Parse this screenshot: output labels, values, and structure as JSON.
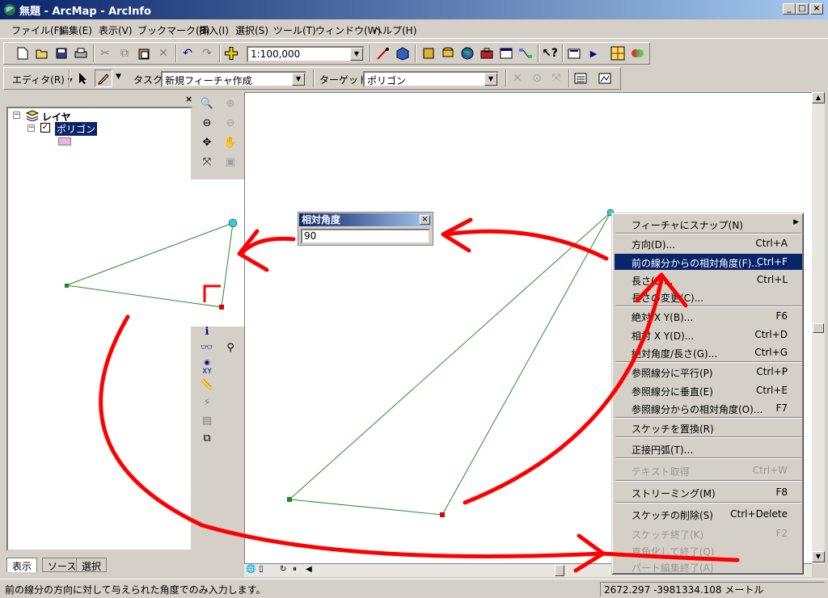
{
  "window": {
    "title": "無題 - ArcMap - ArcInfo",
    "minimize": "_",
    "maximize": "□",
    "close": "×"
  },
  "menubar": [
    "ファイル(F)",
    "編集(E)",
    "表示(V)",
    "ブックマーク(B)",
    "挿入(I)",
    "選択(S)",
    "ツール(T)",
    "ウィンドウ(W)",
    "ヘルプ(H)"
  ],
  "toolbar": {
    "scale": "1:100,000"
  },
  "editor_toolbar": {
    "editor_label": "エディタ(R) ▾",
    "task_label": "タスク:",
    "task_value": "新規フィーチャ作成",
    "target_label": "ターゲット:",
    "target_value": "ポリゴン"
  },
  "toc": {
    "root_label": "レイヤ",
    "layer_label": "ポリゴン",
    "symbol_color": "#e8b4e8",
    "tabs": [
      "表示",
      "ソース",
      "選択"
    ]
  },
  "angle_dialog": {
    "title": "相対角度",
    "value": "90"
  },
  "context_menu": {
    "items": [
      {
        "label": "フィーチャにスナップ(N)",
        "shortcut": "▶",
        "state": "normal"
      },
      {
        "label": "方向(D)...",
        "shortcut": "Ctrl+A",
        "state": "normal"
      },
      {
        "label": "前の線分からの相対角度(F)...",
        "shortcut": "Ctrl+F",
        "state": "highlight"
      },
      {
        "label": "長さ(L)...",
        "shortcut": "Ctrl+L",
        "state": "normal"
      },
      {
        "label": "長さの変更(C)...",
        "shortcut": "",
        "state": "normal"
      },
      {
        "label": "絶対 X Y(B)...",
        "shortcut": "F6",
        "state": "normal"
      },
      {
        "label": "相対 X Y(D)...",
        "shortcut": "Ctrl+D",
        "state": "normal"
      },
      {
        "label": "絶対角度/長さ(G)...",
        "shortcut": "Ctrl+G",
        "state": "normal"
      },
      {
        "label": "参照線分に平行(P)",
        "shortcut": "Ctrl+P",
        "state": "normal"
      },
      {
        "label": "参照線分に垂直(E)",
        "shortcut": "Ctrl+E",
        "state": "normal"
      },
      {
        "label": "参照線分からの相対角度(O)...",
        "shortcut": "F7",
        "state": "normal"
      },
      {
        "label": "スケッチを置換(R)",
        "shortcut": "",
        "state": "normal"
      },
      {
        "label": "正接円弧(T)...",
        "shortcut": "",
        "state": "normal"
      },
      {
        "label": "テキスト取得",
        "shortcut": "Ctrl+W",
        "state": "disabled"
      },
      {
        "label": "ストリーミング(M)",
        "shortcut": "F8",
        "state": "normal"
      },
      {
        "label": "スケッチの削除(S)",
        "shortcut": "Ctrl+Delete",
        "state": "normal"
      },
      {
        "label": "スケッチ終了(K)",
        "shortcut": "F2",
        "state": "disabled"
      },
      {
        "label": "直角化して終了(Q)",
        "shortcut": "",
        "state": "disabled"
      },
      {
        "label": "パート編集終了(A)",
        "shortcut": "",
        "state": "disabled"
      }
    ]
  },
  "statusbar": {
    "message": "前の線分の方向に対して与えられた角度でのみ入力します。",
    "coordinates": "2672.297  -3981334.108 メートル"
  },
  "colors": {
    "title_start": "#0a246a",
    "title_end": "#a6caf0",
    "highlight": "#0a246a",
    "annotation": "#ff0000",
    "sketch_line": "#2e8b2e",
    "vertex": "#1a8a1a",
    "last_vertex": "#e00000",
    "cursor_vertex": "#30d0d0"
  }
}
